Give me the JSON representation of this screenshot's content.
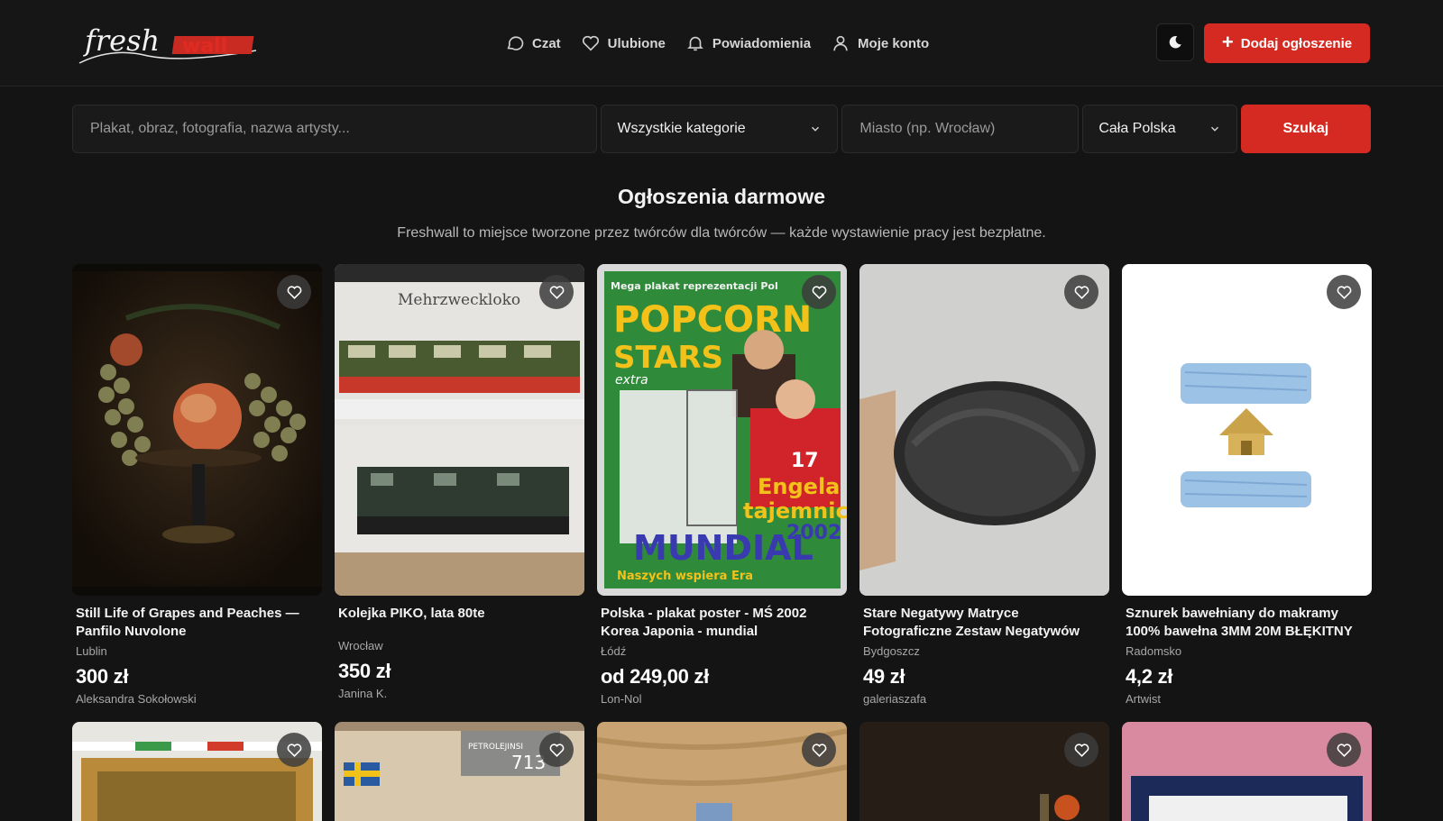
{
  "brand": {
    "logo_text_1": "fresh",
    "logo_text_2": "wall",
    "accent": "#d52a22"
  },
  "nav": {
    "chat": "Czat",
    "favorites": "Ulubione",
    "notifications": "Powiadomienia",
    "account": "Moje konto"
  },
  "header": {
    "add_label": "Dodaj ogłoszenie",
    "theme_icon": "moon-icon"
  },
  "search": {
    "query_placeholder": "Plakat, obraz, fotografia, nazwa artysty...",
    "category": "Wszystkie kategorie",
    "city_placeholder": "Miasto (np. Wrocław)",
    "region": "Cała Polska",
    "button": "Szukaj"
  },
  "section": {
    "title": "Ogłoszenia darmowe",
    "subtitle": "Freshwall to miejsce tworzone przez twórców dla twórców — każde wystawienie pracy jest bezpłatne."
  },
  "listings": [
    {
      "title": "Still Life of Grapes and Peaches — Panfilo Nuvolone",
      "city": "Lublin",
      "price": "300 zł",
      "seller": "Aleksandra Sokołowski"
    },
    {
      "title": "Kolejka PIKO, lata 80te",
      "city": "Wrocław",
      "price": "350 zł",
      "seller": "Janina K."
    },
    {
      "title": "Polska - plakat poster - MŚ 2002 Korea Japonia - mundial reprezentacja",
      "city": "Łódź",
      "price": "od 249,00 zł",
      "seller": "Lon-Nol"
    },
    {
      "title": "Stare Negatywy Matryce Fotograficzne Zestaw Negatywów Fotograficznych.",
      "city": "Bydgoszcz",
      "price": "49 zł",
      "seller": "galeriaszafa"
    },
    {
      "title": "Sznurek bawełniany do makramy 100% bawełna 3MM 20M BŁĘKITNY",
      "city": "Radomsko",
      "price": "4,2 zł",
      "seller": "Artwist"
    }
  ],
  "thumb_texts": {
    "train_label": "Mehrzweckloko",
    "poster_top": "Mega plakat reprezentacji Pol",
    "poster_title_1": "POPCORN",
    "poster_title_2": "STARS",
    "poster_extra": "extra",
    "poster_name": "Engela",
    "poster_secret": "tajemnic",
    "poster_mundial": "MUNDIAL",
    "poster_year": "2002",
    "poster_number": "17",
    "poster_bottom": "Naszych wspiera Era",
    "box_label": "PETROLEJINSI",
    "box_number": "713"
  }
}
